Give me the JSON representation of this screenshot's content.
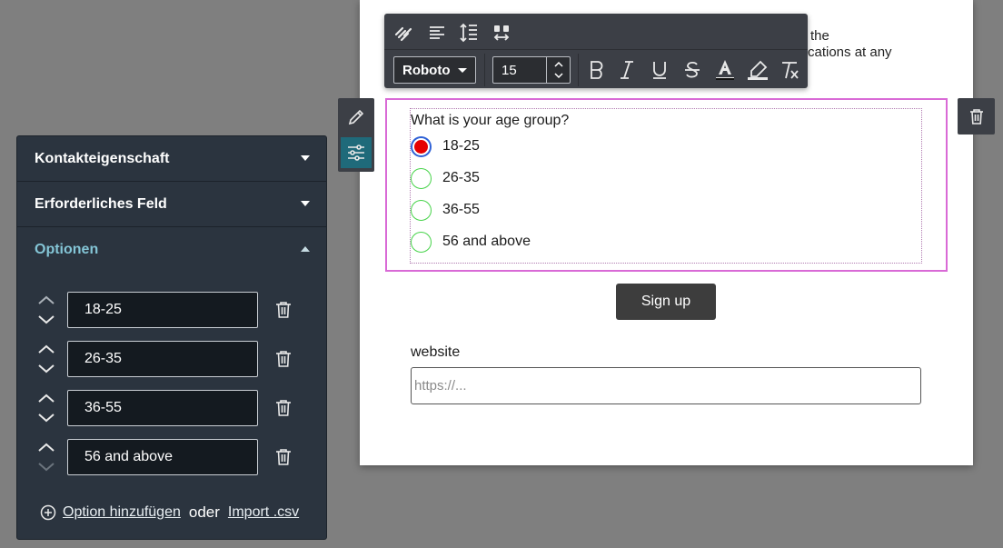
{
  "canvas": {
    "background_text_line1": "the",
    "background_text_line2": "cations at any"
  },
  "rich_toolbar": {
    "row1_icons": [
      "unlink-icon",
      "align-left-icon",
      "line-height-icon",
      "letter-spacing-icon"
    ],
    "font_family_value": "Roboto",
    "font_size_value": "15",
    "format_icons": [
      "bold-icon",
      "italic-icon",
      "underline-icon",
      "strikethrough-icon",
      "text-color-icon",
      "highlight-icon",
      "clear-format-icon"
    ]
  },
  "question": {
    "title": "What is your age group?",
    "options": [
      {
        "label": "18-25",
        "checked": true
      },
      {
        "label": "26-35",
        "checked": false
      },
      {
        "label": "36-55",
        "checked": false
      },
      {
        "label": "56 and above",
        "checked": false
      }
    ]
  },
  "signup_label": "Sign up",
  "website": {
    "label": "website",
    "placeholder": "https://..."
  },
  "panel": {
    "sections": [
      {
        "label": "Kontakteigenschaft",
        "expanded": false
      },
      {
        "label": "Erforderliches Feld",
        "expanded": false
      },
      {
        "label": "Optionen",
        "expanded": true
      }
    ],
    "options": [
      "18-25",
      "26-35",
      "36-55",
      "56 and above"
    ],
    "add_option_label": "Option hinzufügen",
    "or_label": "oder",
    "import_label": "Import .csv"
  },
  "colors": {
    "accent_teal": "#84c5d6",
    "selection_magenta": "#d96ad6",
    "radio_green": "#47d34a",
    "radio_checked_fill": "#e60000"
  }
}
